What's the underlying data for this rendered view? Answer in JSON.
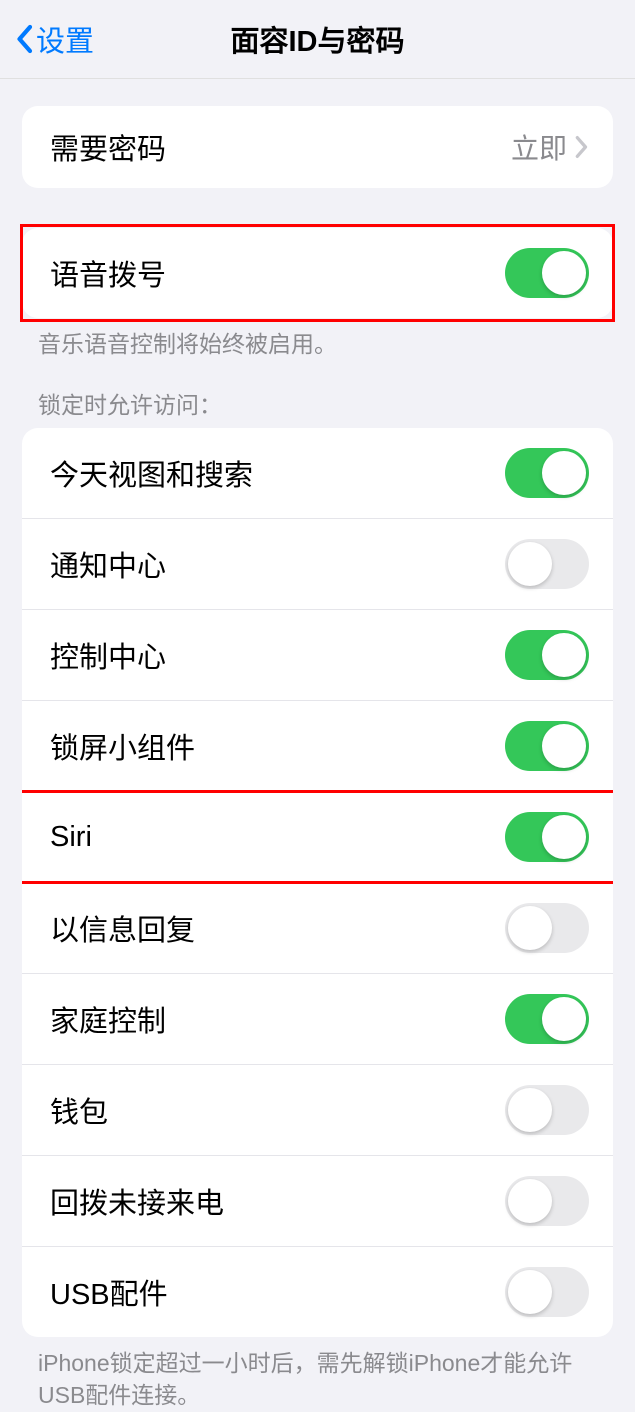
{
  "header": {
    "back_label": "设置",
    "title": "面容ID与密码"
  },
  "passcode_group": {
    "require_passcode_label": "需要密码",
    "require_passcode_value": "立即"
  },
  "voice_dial": {
    "label": "语音拨号",
    "on": true,
    "footer": "音乐语音控制将始终被启用。"
  },
  "lock_screen_access": {
    "header": "锁定时允许访问：",
    "items": [
      {
        "label": "今天视图和搜索",
        "on": true
      },
      {
        "label": "通知中心",
        "on": false
      },
      {
        "label": "控制中心",
        "on": true
      },
      {
        "label": "锁屏小组件",
        "on": true
      },
      {
        "label": "Siri",
        "on": true
      },
      {
        "label": "以信息回复",
        "on": false
      },
      {
        "label": "家庭控制",
        "on": true
      },
      {
        "label": "钱包",
        "on": false
      },
      {
        "label": "回拨未接来电",
        "on": false
      },
      {
        "label": "USB配件",
        "on": false
      }
    ],
    "footer": "iPhone锁定超过一小时后，需先解锁iPhone才能允许USB配件连接。"
  }
}
